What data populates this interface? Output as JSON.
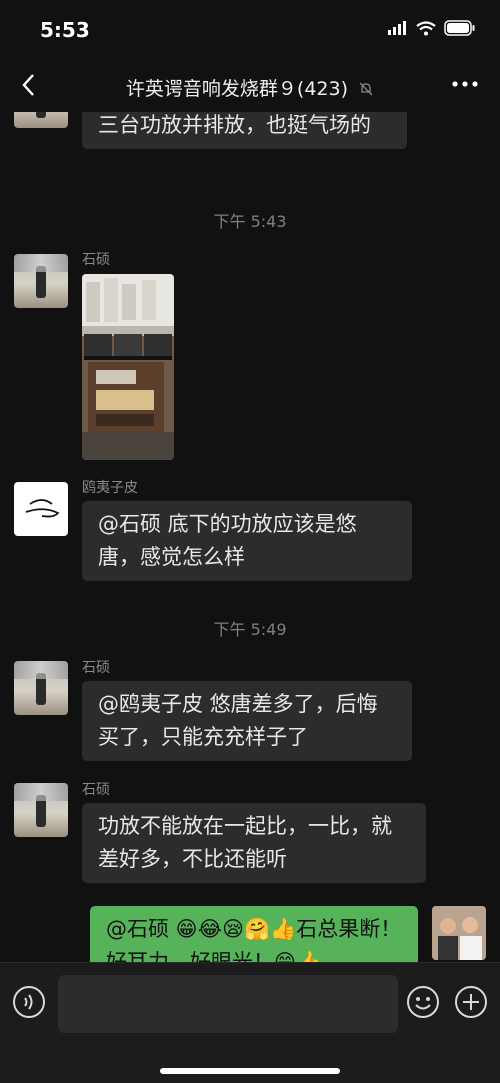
{
  "status": {
    "time": "5:53"
  },
  "header": {
    "title": "许英谔音响发烧群９(423)"
  },
  "messages": {
    "m0_text": "三台功放并排放，也挺气场的",
    "t1": "下午 5:43",
    "m1_name": "石硕",
    "m2_name": "鸥夷子皮",
    "m2_text": "@石硕 底下的功放应该是悠唐，感觉怎么样",
    "t2": "下午 5:49",
    "m3_name": "石硕",
    "m3_text": "@鸥夷子皮 悠唐差多了，后悔买了，只能充充样子了",
    "m4_name": "石硕",
    "m4_text": "功放不能放在一起比，一比，就差好多，不比还能听",
    "m5_text": "@石硕 😁😂😪🤗👍石总果断！好耳力，好眼光！😁👍"
  },
  "input": {
    "placeholder": ""
  },
  "colors": {
    "background": "#111111",
    "bubble": "#2c2c2c",
    "mine_bubble": "#57b35a",
    "timestamp": "#7f7f7f"
  },
  "icons": [
    "back-arrow",
    "mute-bell",
    "more-dots",
    "voice",
    "emoji",
    "plus"
  ]
}
